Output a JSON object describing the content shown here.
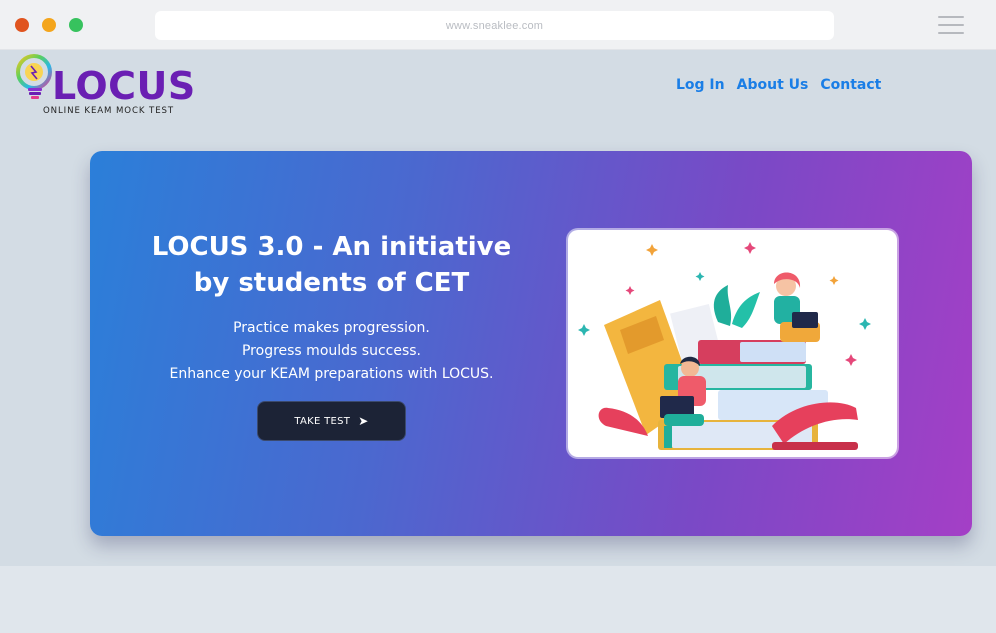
{
  "browser": {
    "url": "www.sneaklee.com"
  },
  "brand": {
    "name": "LOCUS",
    "tagline": "ONLINE KEAM MOCK TEST"
  },
  "nav": {
    "items": [
      {
        "label": "Log In"
      },
      {
        "label": "About Us"
      },
      {
        "label": "Contact"
      }
    ]
  },
  "hero": {
    "title": "LOCUS 3.0 - An initiative by students of CET",
    "lines": [
      "Practice makes progression.",
      "Progress moulds success.",
      "Enhance your KEAM preparations with LOCUS."
    ],
    "cta_label": "TAKE TEST",
    "cta_icon": "send-arrow-icon"
  },
  "colors": {
    "brand_purple": "#6a1fb3",
    "nav_blue": "#1a7ee6",
    "hero_gradient_start": "#2b7fd9",
    "hero_gradient_end": "#a43fc6",
    "cta_bg": "#1c2336"
  }
}
